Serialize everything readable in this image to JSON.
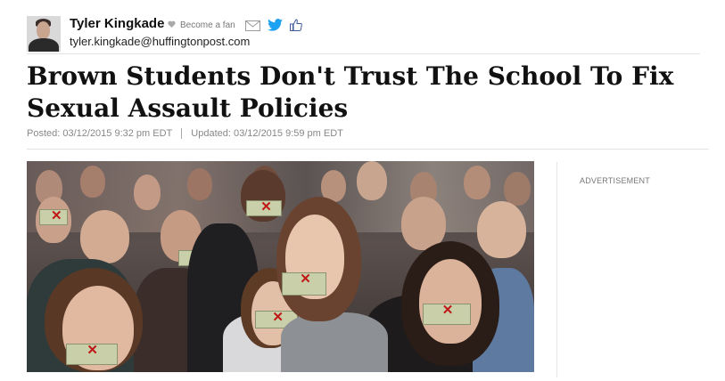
{
  "author": {
    "name": "Tyler Kingkade",
    "email": "tyler.kingkade@huffingtonpost.com",
    "become_fan": "Become a fan"
  },
  "article": {
    "title": "Brown Students Don't Trust The School To Fix Sexual Assault Policies",
    "posted": "Posted: 03/12/2015 9:32 pm EDT",
    "updated": "Updated: 03/12/2015 9:59 pm EDT"
  },
  "sidebar": {
    "ad_label": "ADVERTISEMENT"
  },
  "colors": {
    "twitter": "#1da1f2",
    "facebook": "#3b5998",
    "meta_text": "#888888"
  },
  "icons": [
    "heart-icon",
    "email-icon",
    "twitter-icon",
    "facebook-like-icon"
  ]
}
